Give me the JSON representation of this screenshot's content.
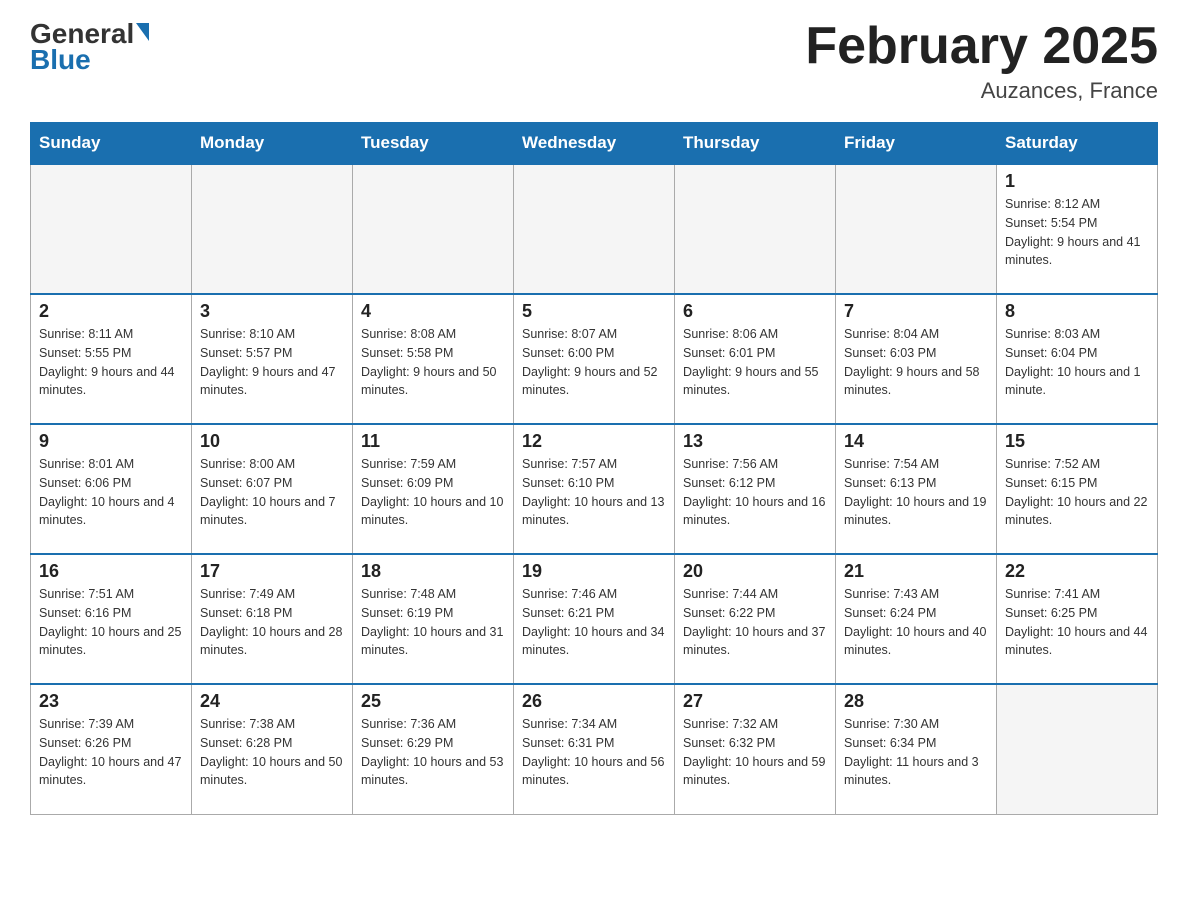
{
  "header": {
    "logo_general": "General",
    "logo_blue": "Blue",
    "title": "February 2025",
    "location": "Auzances, France"
  },
  "days_of_week": [
    "Sunday",
    "Monday",
    "Tuesday",
    "Wednesday",
    "Thursday",
    "Friday",
    "Saturday"
  ],
  "weeks": [
    [
      {
        "day": "",
        "info": ""
      },
      {
        "day": "",
        "info": ""
      },
      {
        "day": "",
        "info": ""
      },
      {
        "day": "",
        "info": ""
      },
      {
        "day": "",
        "info": ""
      },
      {
        "day": "",
        "info": ""
      },
      {
        "day": "1",
        "info": "Sunrise: 8:12 AM\nSunset: 5:54 PM\nDaylight: 9 hours and 41 minutes."
      }
    ],
    [
      {
        "day": "2",
        "info": "Sunrise: 8:11 AM\nSunset: 5:55 PM\nDaylight: 9 hours and 44 minutes."
      },
      {
        "day": "3",
        "info": "Sunrise: 8:10 AM\nSunset: 5:57 PM\nDaylight: 9 hours and 47 minutes."
      },
      {
        "day": "4",
        "info": "Sunrise: 8:08 AM\nSunset: 5:58 PM\nDaylight: 9 hours and 50 minutes."
      },
      {
        "day": "5",
        "info": "Sunrise: 8:07 AM\nSunset: 6:00 PM\nDaylight: 9 hours and 52 minutes."
      },
      {
        "day": "6",
        "info": "Sunrise: 8:06 AM\nSunset: 6:01 PM\nDaylight: 9 hours and 55 minutes."
      },
      {
        "day": "7",
        "info": "Sunrise: 8:04 AM\nSunset: 6:03 PM\nDaylight: 9 hours and 58 minutes."
      },
      {
        "day": "8",
        "info": "Sunrise: 8:03 AM\nSunset: 6:04 PM\nDaylight: 10 hours and 1 minute."
      }
    ],
    [
      {
        "day": "9",
        "info": "Sunrise: 8:01 AM\nSunset: 6:06 PM\nDaylight: 10 hours and 4 minutes."
      },
      {
        "day": "10",
        "info": "Sunrise: 8:00 AM\nSunset: 6:07 PM\nDaylight: 10 hours and 7 minutes."
      },
      {
        "day": "11",
        "info": "Sunrise: 7:59 AM\nSunset: 6:09 PM\nDaylight: 10 hours and 10 minutes."
      },
      {
        "day": "12",
        "info": "Sunrise: 7:57 AM\nSunset: 6:10 PM\nDaylight: 10 hours and 13 minutes."
      },
      {
        "day": "13",
        "info": "Sunrise: 7:56 AM\nSunset: 6:12 PM\nDaylight: 10 hours and 16 minutes."
      },
      {
        "day": "14",
        "info": "Sunrise: 7:54 AM\nSunset: 6:13 PM\nDaylight: 10 hours and 19 minutes."
      },
      {
        "day": "15",
        "info": "Sunrise: 7:52 AM\nSunset: 6:15 PM\nDaylight: 10 hours and 22 minutes."
      }
    ],
    [
      {
        "day": "16",
        "info": "Sunrise: 7:51 AM\nSunset: 6:16 PM\nDaylight: 10 hours and 25 minutes."
      },
      {
        "day": "17",
        "info": "Sunrise: 7:49 AM\nSunset: 6:18 PM\nDaylight: 10 hours and 28 minutes."
      },
      {
        "day": "18",
        "info": "Sunrise: 7:48 AM\nSunset: 6:19 PM\nDaylight: 10 hours and 31 minutes."
      },
      {
        "day": "19",
        "info": "Sunrise: 7:46 AM\nSunset: 6:21 PM\nDaylight: 10 hours and 34 minutes."
      },
      {
        "day": "20",
        "info": "Sunrise: 7:44 AM\nSunset: 6:22 PM\nDaylight: 10 hours and 37 minutes."
      },
      {
        "day": "21",
        "info": "Sunrise: 7:43 AM\nSunset: 6:24 PM\nDaylight: 10 hours and 40 minutes."
      },
      {
        "day": "22",
        "info": "Sunrise: 7:41 AM\nSunset: 6:25 PM\nDaylight: 10 hours and 44 minutes."
      }
    ],
    [
      {
        "day": "23",
        "info": "Sunrise: 7:39 AM\nSunset: 6:26 PM\nDaylight: 10 hours and 47 minutes."
      },
      {
        "day": "24",
        "info": "Sunrise: 7:38 AM\nSunset: 6:28 PM\nDaylight: 10 hours and 50 minutes."
      },
      {
        "day": "25",
        "info": "Sunrise: 7:36 AM\nSunset: 6:29 PM\nDaylight: 10 hours and 53 minutes."
      },
      {
        "day": "26",
        "info": "Sunrise: 7:34 AM\nSunset: 6:31 PM\nDaylight: 10 hours and 56 minutes."
      },
      {
        "day": "27",
        "info": "Sunrise: 7:32 AM\nSunset: 6:32 PM\nDaylight: 10 hours and 59 minutes."
      },
      {
        "day": "28",
        "info": "Sunrise: 7:30 AM\nSunset: 6:34 PM\nDaylight: 11 hours and 3 minutes."
      },
      {
        "day": "",
        "info": ""
      }
    ]
  ]
}
